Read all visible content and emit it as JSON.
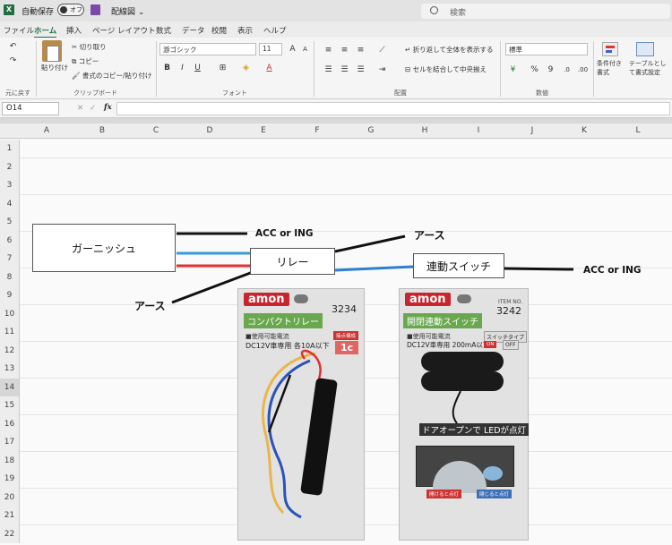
{
  "titlebar": {
    "autosave_label": "自動保存",
    "autosave_state": "オフ",
    "document_name": "配線図 ⌄",
    "search_placeholder": "検索"
  },
  "tabs": [
    {
      "label": "ファイル",
      "active": false
    },
    {
      "label": "ホーム",
      "active": true
    },
    {
      "label": "挿入",
      "active": false
    },
    {
      "label": "ページ レイアウト",
      "active": false
    },
    {
      "label": "数式",
      "active": false
    },
    {
      "label": "データ",
      "active": false
    },
    {
      "label": "校閲",
      "active": false
    },
    {
      "label": "表示",
      "active": false
    },
    {
      "label": "ヘルプ",
      "active": false
    }
  ],
  "ribbon": {
    "undo_group": "元に戻す",
    "paste_label": "貼り付け",
    "cut_label": "切り取り",
    "copy_label": "コピー",
    "format_painter_label": "書式のコピー/貼り付け",
    "clipboard_group": "クリップボード",
    "font_name": "游ゴシック",
    "font_size": "11",
    "font_group": "フォント",
    "wrap_text_label": "折り返して全体を表示する",
    "merge_center_label": "セルを結合して中央揃え",
    "alignment_group": "配置",
    "number_format": "標準",
    "number_group": "数値",
    "conditional_format_label": "条件付き書式",
    "table_format_label": "テーブルとして書式設定"
  },
  "formula_bar": {
    "name_box": "O14",
    "fx_label": "fx",
    "formula": ""
  },
  "columns": [
    "A",
    "B",
    "C",
    "D",
    "E",
    "F",
    "G",
    "H",
    "I",
    "J",
    "K",
    "L"
  ],
  "rows": [
    "1",
    "2",
    "3",
    "4",
    "5",
    "6",
    "7",
    "8",
    "9",
    "10",
    "11",
    "12",
    "13",
    "14",
    "15",
    "16",
    "17",
    "18",
    "19",
    "20",
    "21",
    "22"
  ],
  "diagram": {
    "garnish_label": "ガーニッシュ",
    "relay_label": "リレー",
    "switch_label": "連動スイッチ",
    "acc_ing_1": "ACC or ING",
    "acc_ing_2": "ACC or ING",
    "ground_1": "アース",
    "ground_2": "アース",
    "colors": {
      "black": "#111111",
      "light_blue": "#3a9ad9",
      "red": "#e03030",
      "blue": "#2f7fd0"
    }
  },
  "package_relay": {
    "brand": "amon",
    "code": "3234",
    "title": "コンパクトリレー",
    "spec_line1": "■使用可能電流",
    "spec_line2": "DC12V車専用 各10A以下",
    "contact_header": "接点構成",
    "contact_value": "1c"
  },
  "package_switch": {
    "brand": "amon",
    "code_small": "ITEM NO.",
    "code": "3242",
    "title": "開閉連動スイッチ",
    "spec_line1": "■使用可能電流",
    "spec_line2": "DC12V車専用 200mA以下",
    "switch_type": "スイッチタイプ",
    "on_label": "ON",
    "off_label": "OFF",
    "promo": "ドアオープンで LEDが点灯",
    "tag_left": "開けると点灯",
    "tag_right": "閉じると点灯"
  }
}
